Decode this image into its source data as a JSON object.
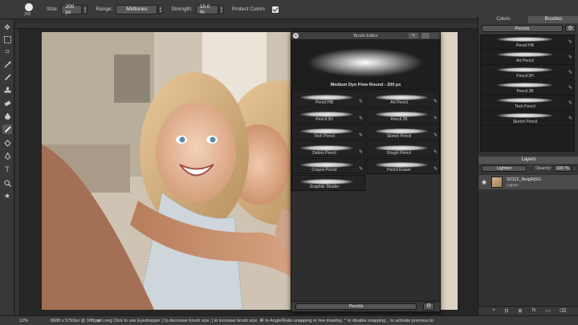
{
  "options": {
    "brush_size_num": "200",
    "size_label": "Size:",
    "size_value": "200 px",
    "range_label": "Range:",
    "range_value": "Midtones",
    "strength_label": "Strength:",
    "strength_value": "10.0 %",
    "protect_label": "Protect Colors",
    "protect_checked": true
  },
  "toolbar": {
    "tools": [
      "move-icon",
      "marquee-icon",
      "crop-icon",
      "eyedropper-icon",
      "brush-icon",
      "stamp-icon",
      "eraser-icon",
      "blur-icon",
      "dodge-icon",
      "pen-icon",
      "text-icon",
      "shape-icon",
      "zoom-icon",
      "star-icon"
    ]
  },
  "brush_editor": {
    "title": "Brush Editor",
    "add_label": "+",
    "preview_name": "Medium Dyn Flow Round - 200 px",
    "brushes": [
      "Pencil HB",
      "Art Pencil",
      "Pencil 3H",
      "Pencil 2B",
      "Tech Pencil",
      "Sketch Pencil",
      "Debris Pencil",
      "Rough Pencil",
      "Crayon Pencil",
      "Pencil Eraser",
      "Graphite Shader"
    ],
    "footer_select": "Pencils",
    "footer_gear": "⚙"
  },
  "right_panel": {
    "tabs": [
      "Colors",
      "Brushes"
    ],
    "active_tab": "Brushes",
    "preset": "Pencils",
    "gear": "⚙",
    "brushes": [
      "Pencil HB",
      "Art Pencil",
      "Pencil 3H",
      "Pencil 2B",
      "Tech Pencil",
      "Sketch Pencil"
    ],
    "layers_title": "Layers",
    "blend_mode": "Lighten",
    "opacity_label": "Opacity:",
    "opacity_value": "100 %",
    "layer": {
      "name": "S2112_NelgRjSG",
      "mode": "Lighten"
    },
    "footer_icons": [
      "+",
      "fx",
      "⊡",
      "⊞",
      "▭",
      "⌫"
    ]
  },
  "status": {
    "zoom": "12%",
    "doc": "8688 x 5792px @ 300 ppi",
    "hint": "⌥ or Long Click to use Eyedropper. [ to decrease brush size. ] to increase brush size. ⌘ to Angle/Ratio snapping or line drawing. ^ to disable snapping. , to activate previous br"
  },
  "colors": {
    "panel_bg": "#323232",
    "accent": "#535353"
  }
}
